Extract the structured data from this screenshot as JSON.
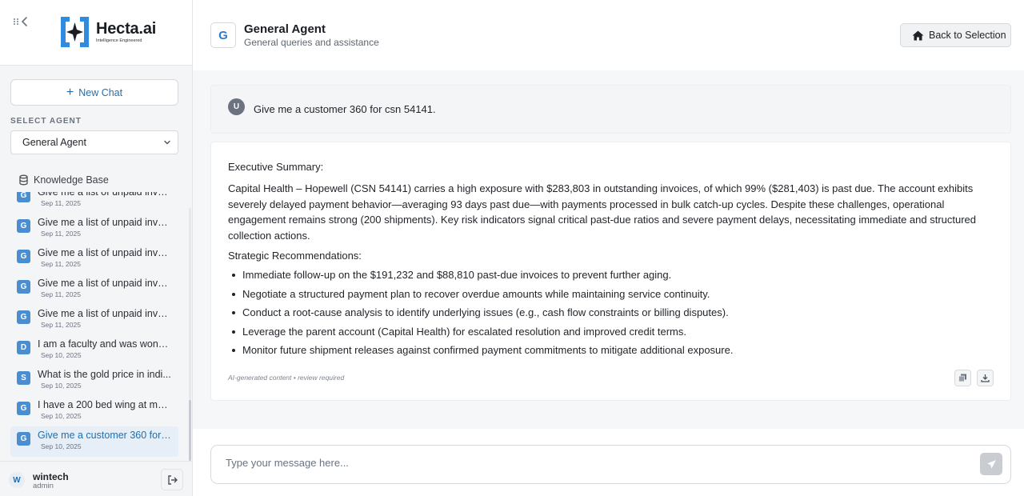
{
  "sidebar": {
    "logo": {
      "name": "Hecta.ai",
      "tagline": "Intelligence Engineered"
    },
    "new_chat_label": "New Chat",
    "select_agent_label": "SELECT AGENT",
    "selected_agent": "General Agent",
    "knowledge_base_label": "Knowledge Base",
    "history": [
      {
        "badge": "G",
        "title": "Give me a list of unpaid invoices",
        "date": "Sep 11, 2025"
      },
      {
        "badge": "G",
        "title": "Give me a list of unpaid invoi...",
        "date": "Sep 11, 2025"
      },
      {
        "badge": "G",
        "title": "Give me a list of unpaid invoi...",
        "date": "Sep 11, 2025"
      },
      {
        "badge": "G",
        "title": "Give me a list of unpaid invoi...",
        "date": "Sep 11, 2025"
      },
      {
        "badge": "G",
        "title": "Give me a list of unpaid invoi...",
        "date": "Sep 11, 2025"
      },
      {
        "badge": "D",
        "title": "I am a faculty and was wond...",
        "date": "Sep 10, 2025"
      },
      {
        "badge": "S",
        "title": "What is the gold price in indi...",
        "date": "Sep 10, 2025"
      },
      {
        "badge": "G",
        "title": "I have a 200 bed wing at my ...",
        "date": "Sep 10, 2025"
      },
      {
        "badge": "G",
        "title": "Give me a customer 360 for ...",
        "date": "Sep 10, 2025"
      }
    ],
    "user": {
      "initial": "W",
      "name": "wintech",
      "role": "admin"
    }
  },
  "header": {
    "agent_initial": "G",
    "agent_name": "General Agent",
    "agent_description": "General queries and assistance",
    "back_button_label": "Back to Selection"
  },
  "conversation": {
    "user_initial": "U",
    "user_message": "Give me a customer 360 for csn 54141.",
    "response": {
      "summary_title": "Executive Summary:",
      "summary_text": "Capital Health – Hopewell (CSN 54141) carries a high exposure with $283,803 in outstanding invoices, of which 99% ($281,403) is past due. The account exhibits severely delayed payment behavior—averaging 93 days past due—with payments processed in bulk catch-up cycles. Despite these challenges, operational engagement remains strong (200 shipments). Key risk indicators signal critical past-due ratios and severe payment delays, necessitating immediate and structured collection actions.",
      "recommendations_title": "Strategic Recommendations:",
      "recommendations": [
        "Immediate follow-up on the $191,232 and $88,810 past-due invoices to prevent further aging.",
        "Negotiate a structured payment plan to recover overdue amounts while maintaining service continuity.",
        "Conduct a root-cause analysis to identify underlying issues (e.g., cash flow constraints or billing disputes).",
        "Leverage the parent account (Capital Health) for escalated resolution and improved credit terms.",
        "Monitor future shipment releases against confirmed payment commitments to mitigate additional exposure."
      ],
      "disclaimer": "AI-generated content • review required"
    }
  },
  "composer": {
    "placeholder": "Type your message here..."
  }
}
